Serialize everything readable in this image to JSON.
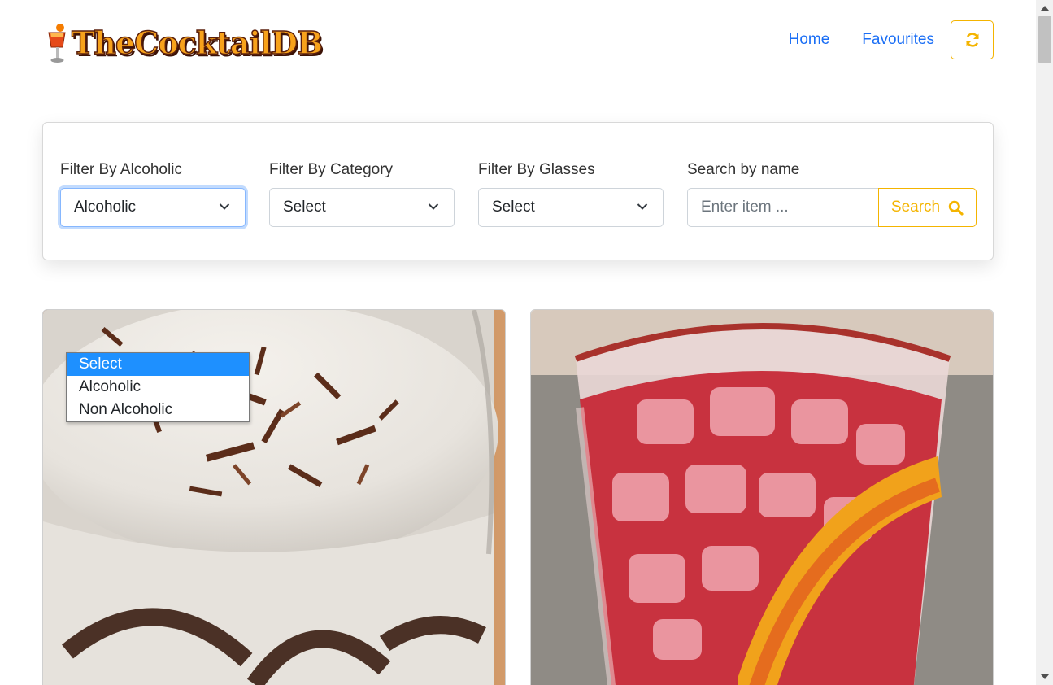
{
  "header": {
    "logo_text": "TheCocktailDB",
    "nav": [
      {
        "label": "Home"
      },
      {
        "label": "Favourites"
      }
    ],
    "refresh_icon": "refresh-icon"
  },
  "filters": {
    "alcoholic": {
      "label": "Filter By Alcoholic",
      "selected": "Alcoholic"
    },
    "category": {
      "label": "Filter By Category",
      "selected": "Select"
    },
    "glasses": {
      "label": "Filter By Glasses",
      "selected": "Select"
    },
    "search": {
      "label": "Search by name",
      "placeholder": "Enter item ...",
      "button_label": "Search",
      "icon": "search-icon"
    }
  },
  "dropdown": {
    "options": [
      "Select",
      "Alcoholic",
      "Non Alcoholic"
    ],
    "highlighted": "Select"
  },
  "colors": {
    "link": "#1a6ef5",
    "accent": "#f4b400",
    "dropdown_highlight": "#1e90ff"
  }
}
